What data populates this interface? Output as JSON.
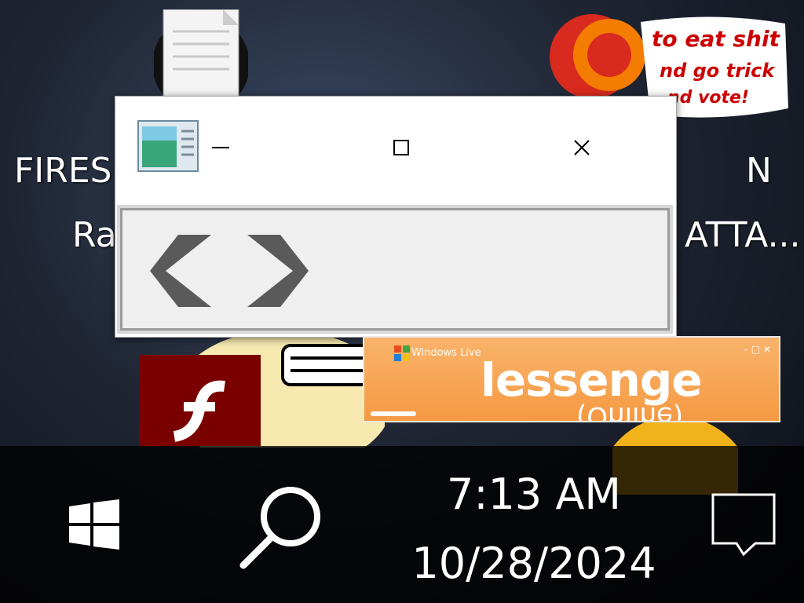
{
  "desktop": {
    "left_labels": [
      "FIRES",
      "Ra"
    ],
    "right_labels": [
      "N",
      "ATTA..."
    ],
    "speech_text": [
      "to eat shit",
      "nd go trick",
      "nd vote!"
    ]
  },
  "dialog": {
    "minimize_glyph": "—",
    "close_glyph": "✕"
  },
  "messenger": {
    "brand": "Windows Live",
    "title_fragment": "lessenge",
    "status_fragment": "(Online)",
    "controls": "– □ ✕"
  },
  "taskbar": {
    "time": "7:13 AM",
    "date": "10/28/2024"
  },
  "icons": {
    "dialog_app": "window-app-icon",
    "back": "chevron-left-icon",
    "forward": "chevron-right-icon",
    "start": "windows-logo-icon",
    "search": "search-icon",
    "notifications": "action-center-icon"
  }
}
